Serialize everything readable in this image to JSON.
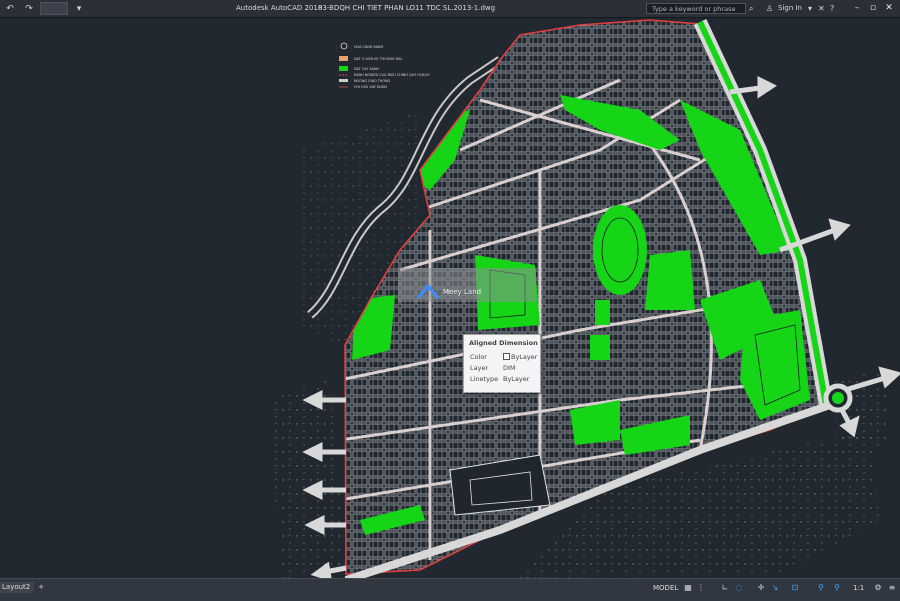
{
  "titlebar": {
    "app": "Autodesk AutoCAD 2018",
    "document": "03-BDQH CHI TIET PHAN LO11 TDC SL.2013-1.dwg",
    "search_placeholder": "Type a keyword or phrase",
    "sign_in": "Sign In",
    "qat_icons": [
      "undo-icon",
      "redo-icon",
      "dropdown-icon"
    ],
    "right_icons": [
      "search-icon",
      "user-icon",
      "exchange-icon",
      "help-icon"
    ],
    "window_buttons": [
      "minimize-icon",
      "restore-icon",
      "close-icon"
    ]
  },
  "drawing": {
    "colors": {
      "background": "#212830",
      "green": "#16d416",
      "road": "#d4c9c9",
      "boundary": "#e04040"
    },
    "watermark": "Meey Land",
    "legend": [
      "HOA CANH BANH",
      "DAT O LIEN KE THUONG MAI",
      "DAT CAY XANH",
      "RANH NGHIEN CUU DIEU CHINH QUY HOACH",
      "NGONG GIAO THONG",
      "CHI GIOI XAY DUNG"
    ]
  },
  "tooltip": {
    "title": "Aligned Dimension",
    "rows": [
      {
        "key": "Color",
        "value": "ByLayer",
        "swatch": true
      },
      {
        "key": "Layer",
        "value": "DIM"
      },
      {
        "key": "Linetype",
        "value": "ByLayer"
      }
    ]
  },
  "statusbar": {
    "layout_tab": "Layout2",
    "add_tab": "+",
    "model": "MODEL",
    "scale": "1:1",
    "icons": [
      "grid-icon",
      "snap-icon",
      "ortho-icon",
      "polar-icon",
      "osnap-icon",
      "otrack-icon",
      "annotation-icon",
      "workspace-icon",
      "settings-icon"
    ]
  }
}
